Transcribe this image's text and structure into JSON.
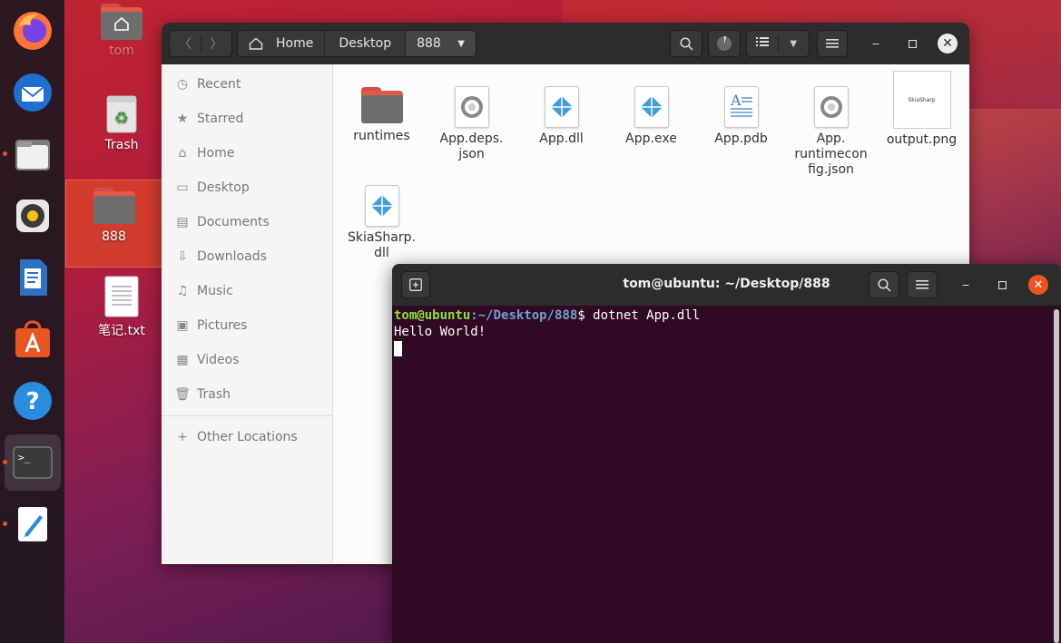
{
  "desktop": {
    "icons": [
      {
        "label": "tom"
      },
      {
        "label": "Trash"
      },
      {
        "label": "888"
      },
      {
        "label": "笔记.txt"
      }
    ]
  },
  "dock": {
    "apps": [
      "firefox-icon",
      "thunderbird-icon",
      "files-icon",
      "rhythmbox-icon",
      "libreoffice-writer-icon",
      "software-icon",
      "help-icon",
      "terminal-icon",
      "text-editor-icon"
    ]
  },
  "files_window": {
    "breadcrumbs": [
      "Home",
      "Desktop",
      "888"
    ],
    "sidebar": [
      {
        "label": "Recent",
        "icon": "clock-icon"
      },
      {
        "label": "Starred",
        "icon": "star-icon"
      },
      {
        "label": "Home",
        "icon": "home-icon"
      },
      {
        "label": "Desktop",
        "icon": "desktop-icon"
      },
      {
        "label": "Documents",
        "icon": "documents-icon"
      },
      {
        "label": "Downloads",
        "icon": "downloads-icon"
      },
      {
        "label": "Music",
        "icon": "music-icon"
      },
      {
        "label": "Pictures",
        "icon": "pictures-icon"
      },
      {
        "label": "Videos",
        "icon": "videos-icon"
      },
      {
        "label": "Trash",
        "icon": "trash-icon"
      }
    ],
    "other_locations": "Other Locations",
    "files": [
      {
        "label": "runtimes",
        "type": "folder"
      },
      {
        "label": "App.deps.\njson",
        "type": "json"
      },
      {
        "label": "App.dll",
        "type": "dll"
      },
      {
        "label": "App.exe",
        "type": "dll"
      },
      {
        "label": "App.pdb",
        "type": "text"
      },
      {
        "label": "App.\nruntimecon\nfig.json",
        "type": "json"
      },
      {
        "label": "output.png",
        "type": "image",
        "thumb_text": "SkiaSharp"
      },
      {
        "label": "SkiaSharp.\ndll",
        "type": "dll"
      }
    ]
  },
  "terminal": {
    "title": "tom@ubuntu: ~/Desktop/888",
    "prompt_user": "tom@ubuntu",
    "prompt_path": ":~/Desktop/888",
    "prompt_symbol": "$ ",
    "command": "dotnet App.dll",
    "output": "Hello World!"
  },
  "colors": {
    "accent": "#e95420",
    "terminal_bg": "#300a24",
    "dll_blue": "#3e9fd9"
  }
}
